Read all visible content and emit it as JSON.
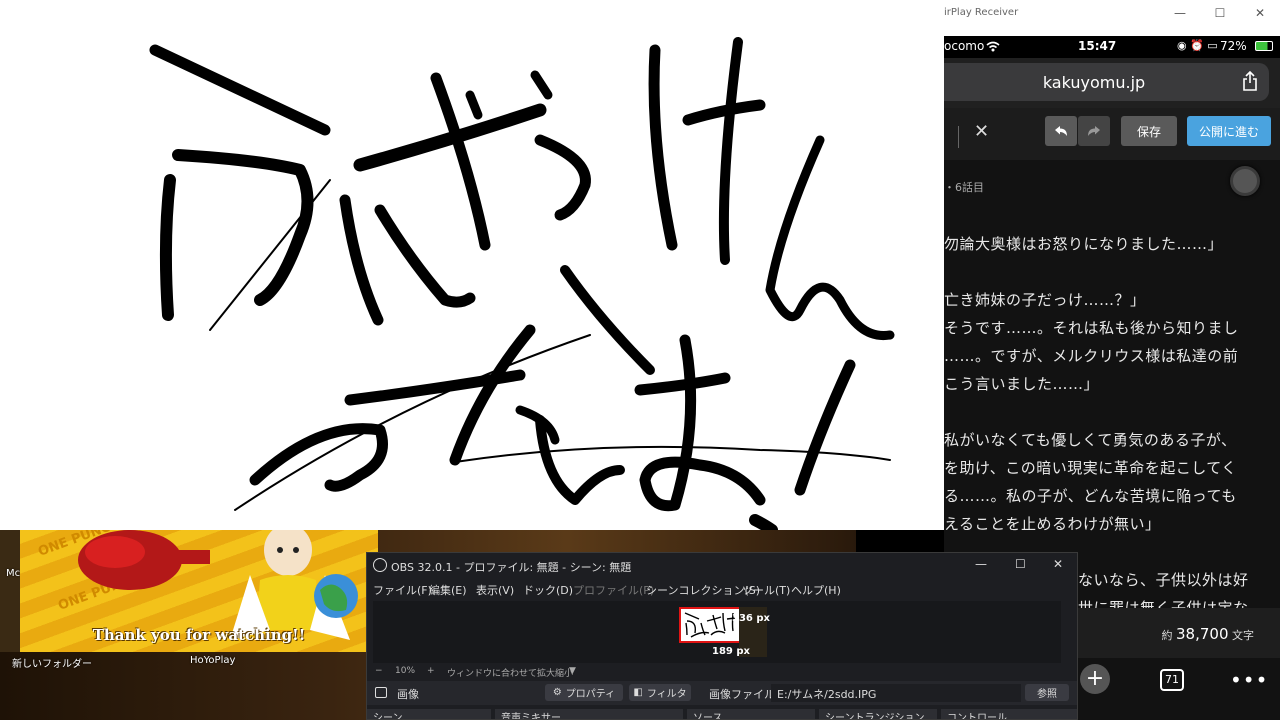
{
  "canvas": {
    "handwriting": "うだっけんつなよ！"
  },
  "airplay": {
    "window_title": "AirPlay Receiver",
    "window_title_visible": "irPlay Receiver",
    "status": {
      "carrier": "ocomo",
      "time": "15:47",
      "battery": "72%"
    },
    "url": "kakuyomu.jp",
    "toolbar": {
      "save": "保存",
      "publish": "公開に進む"
    },
    "episode_label": "・6話目",
    "lines": [
      "勿論大奥様はお怒りになりました……」",
      "",
      "亡き姉妹の子だっけ……？」",
      "そうです……。それは私も後から知りまし",
      "……。ですが、メルクリウス様は私達の前",
      "こう言いました……」",
      "",
      "私がいなくても優しくて勇気のある子が、",
      "を助け、この暗い現実に革命を起こしてく",
      "る……。私の子が、どんな苦境に陥っても",
      "えることを止めるわけが無い」",
      "",
      "ないなら、子供以外は好",
      "世に罪は無く子供は宝な"
    ],
    "char_count_prefix": "約",
    "char_count": "38,700",
    "char_count_suffix": "文字",
    "tab_count": "71"
  },
  "desktop": {
    "thumbnail_caption": "Thank you for watching!!",
    "folder_label": "新しいフォルダー",
    "app_label": "HoYoPlay",
    "cut_label": "Mc"
  },
  "obs": {
    "title": "OBS 32.0.1 - プロファイル: 無題 - シーン: 無題",
    "menu": [
      "ファイル(F)",
      "編集(E)",
      "表示(V)",
      "ドック(D)",
      "プロファイル(P)",
      "シーンコレクション(S)",
      "ツール(T)",
      "ヘルプ(H)"
    ],
    "zoom": {
      "minus": "−",
      "value": "10%",
      "plus": "+",
      "fit": "ウィンドウに合わせて拡大縮小"
    },
    "width_label": "336 px",
    "height_label": "189 px",
    "source_name": "画像",
    "properties": "プロパティ",
    "filters": "フィルタ",
    "image_file_label": "画像ファイル",
    "image_path": "E:/サムネ/2sdd.IPG",
    "browse": "参照",
    "docks": [
      "シーン",
      "音声ミキサー",
      "ソース",
      "シーントランジション",
      "コントロール"
    ]
  },
  "colors": {
    "publish_button": "#4aa3df",
    "obs_bg": "#1d1e22",
    "selection_red": "#e01414"
  }
}
